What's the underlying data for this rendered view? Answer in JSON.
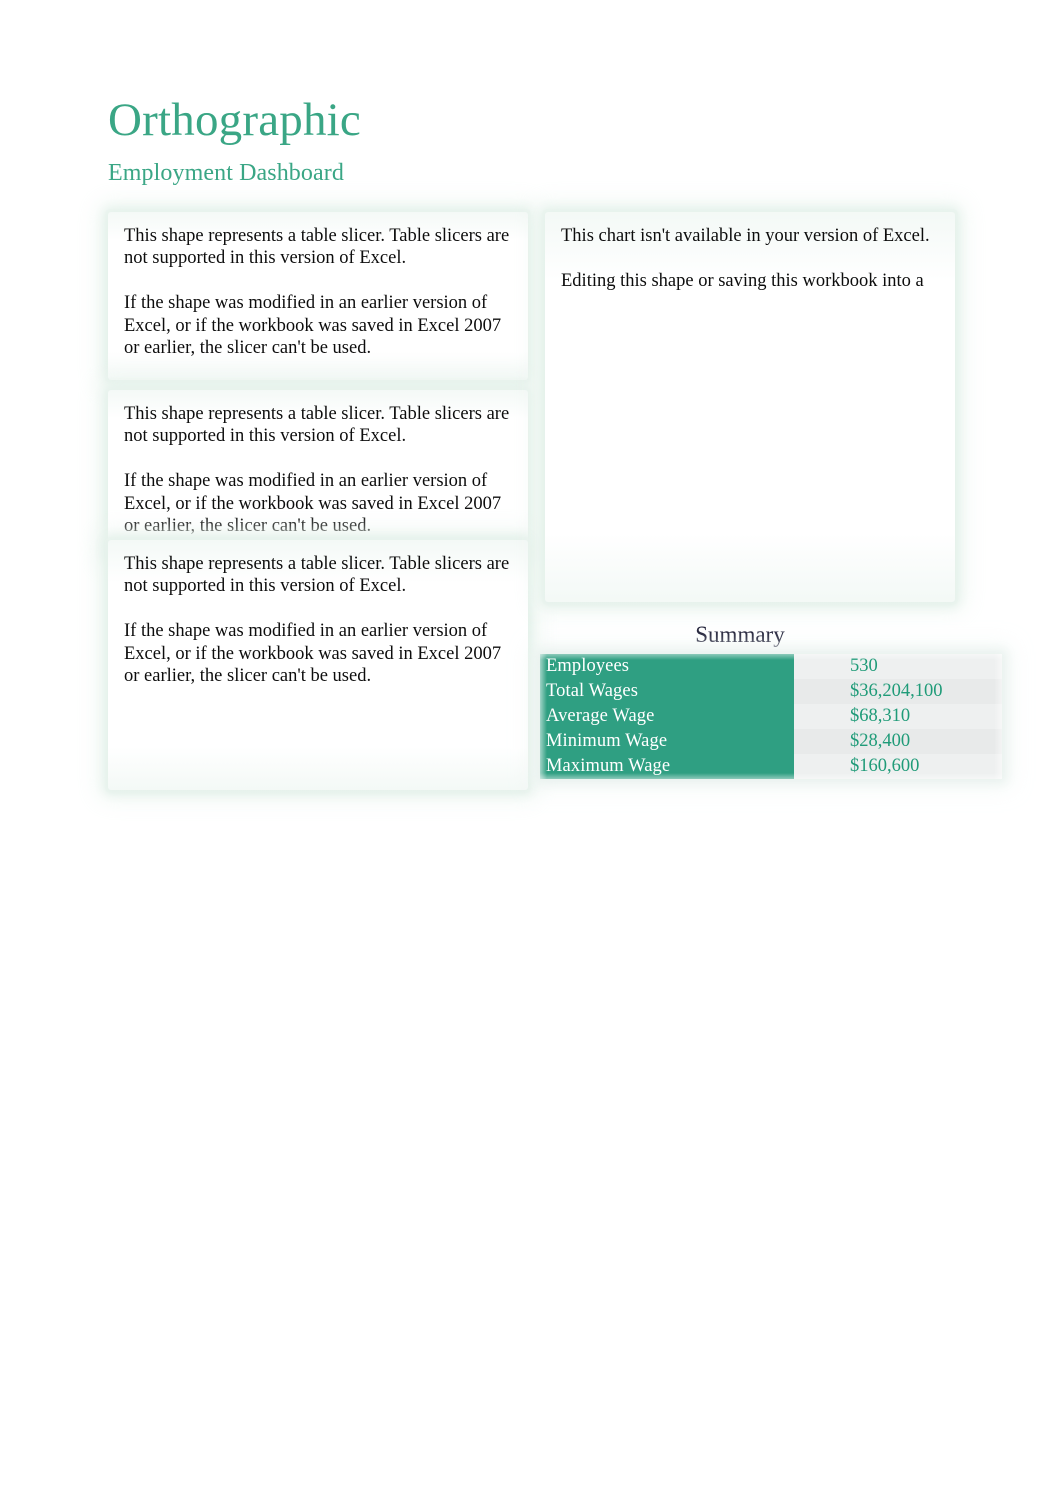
{
  "header": {
    "title": "Orthographic",
    "subtitle": "Employment Dashboard",
    "accent_color": "#3aa685"
  },
  "slicers": [
    {
      "name": "slicer-placeholder-1",
      "text": "This shape represents a table slicer. Table slicers are not supported in this version of Excel.\n\nIf the shape was modified in an earlier version of Excel, or if the workbook was saved in Excel 2007 or earlier, the slicer can't be used."
    },
    {
      "name": "slicer-placeholder-2",
      "text": "This shape represents a table slicer. Table slicers are not supported in this version of Excel.\n\nIf the shape was modified in an earlier version of Excel, or if the workbook was saved in Excel 2007 or earlier, the slicer can't be used."
    },
    {
      "name": "slicer-placeholder-3",
      "text": "This shape represents a table slicer. Table slicers are not supported in this version of Excel.\n\nIf the shape was modified in an earlier version of Excel, or if the workbook was saved in Excel 2007 or earlier, the slicer can't be used."
    }
  ],
  "chart_placeholder": {
    "text": "This chart isn't available in your version of Excel.\n\nEditing this shape or saving this workbook into a"
  },
  "summary": {
    "title": "Summary",
    "label_fill_color": "#2f9f82",
    "label_text_color": "#ffffff",
    "value_fill_color": "#eceeee",
    "value_text_color": "#1f9b78",
    "rows": [
      {
        "label": "Employees",
        "value": "530"
      },
      {
        "label": "Total Wages",
        "value": "$36,204,100"
      },
      {
        "label": "Average Wage",
        "value": "$68,310"
      },
      {
        "label": "Minimum Wage",
        "value": "$28,400"
      },
      {
        "label": "Maximum Wage",
        "value": "$160,600"
      }
    ]
  }
}
